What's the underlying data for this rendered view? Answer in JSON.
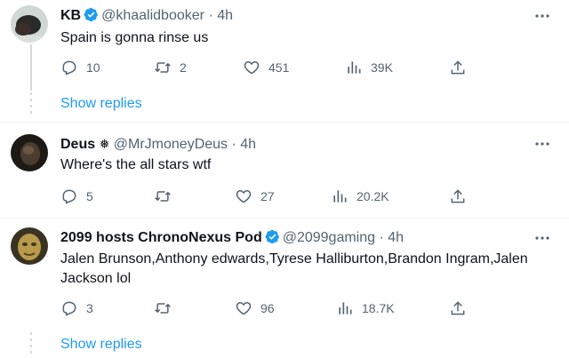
{
  "colors": {
    "accent": "#1d9bf0",
    "secondary_text": "#536471",
    "primary_text": "#0f1419"
  },
  "tweets": [
    {
      "name": "KB",
      "verified": true,
      "handle": "@khaalidbooker",
      "sep": "·",
      "time": "4h",
      "text": "Spain is gonna rinse us",
      "replies": "10",
      "retweets": "2",
      "likes": "451",
      "views": "39K",
      "show_replies": "Show replies"
    },
    {
      "name": "Deus",
      "badge": "❅",
      "handle": "@MrJmoneyDeus",
      "sep": "·",
      "time": "4h",
      "text": "Where's the all stars wtf",
      "replies": "5",
      "retweets": "",
      "likes": "27",
      "views": "20.2K"
    },
    {
      "name": "2099 hosts ChronoNexus Pod",
      "verified": true,
      "handle": "@2099gaming",
      "sep": "·",
      "time": "4h",
      "text": "Jalen Brunson,Anthony edwards,Tyrese Halliburton,Brandon Ingram,Jalen Jackson lol",
      "replies": "3",
      "retweets": "",
      "likes": "96",
      "views": "18.7K",
      "show_replies": "Show replies"
    }
  ]
}
